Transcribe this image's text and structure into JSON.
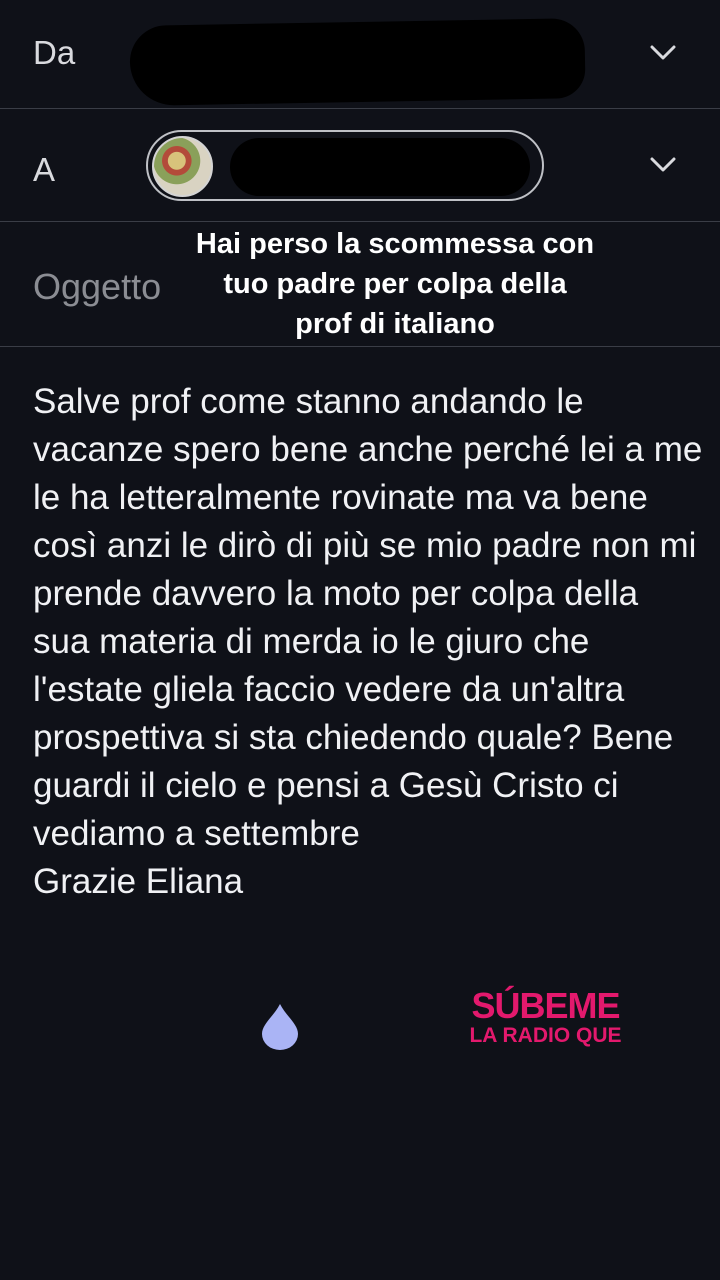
{
  "header": {
    "from_label": "Da",
    "to_label": "A",
    "subject_label": "Oggetto"
  },
  "subject_overlay": "Hai perso la scommessa con tuo padre per colpa della prof  di italiano",
  "body": "Salve prof come stanno andando le vacanze spero bene anche perché lei a me le ha letteralmente rovinate ma va bene così anzi le dirò di più se mio padre non mi prende davvero la moto per colpa della sua materia di merda io le giuro che l'estate gliela faccio vedere da un'altra prospettiva si sta chiedendo quale? Bene guardi il cielo e pensi a Gesù Cristo ci vediamo a settembre\nGrazie Eliana",
  "watermark": {
    "line1": "SÚBEME",
    "line2": "LA RADIO QUE",
    "color": "#e3196d"
  },
  "icons": {
    "from_dropdown": "chevron-down-icon",
    "to_dropdown": "chevron-down-icon",
    "cursor": "text-cursor-drop-icon"
  },
  "colors": {
    "background": "#0f1118",
    "divider": "#3a3d46",
    "cursor_handle": "#aab4f5"
  }
}
